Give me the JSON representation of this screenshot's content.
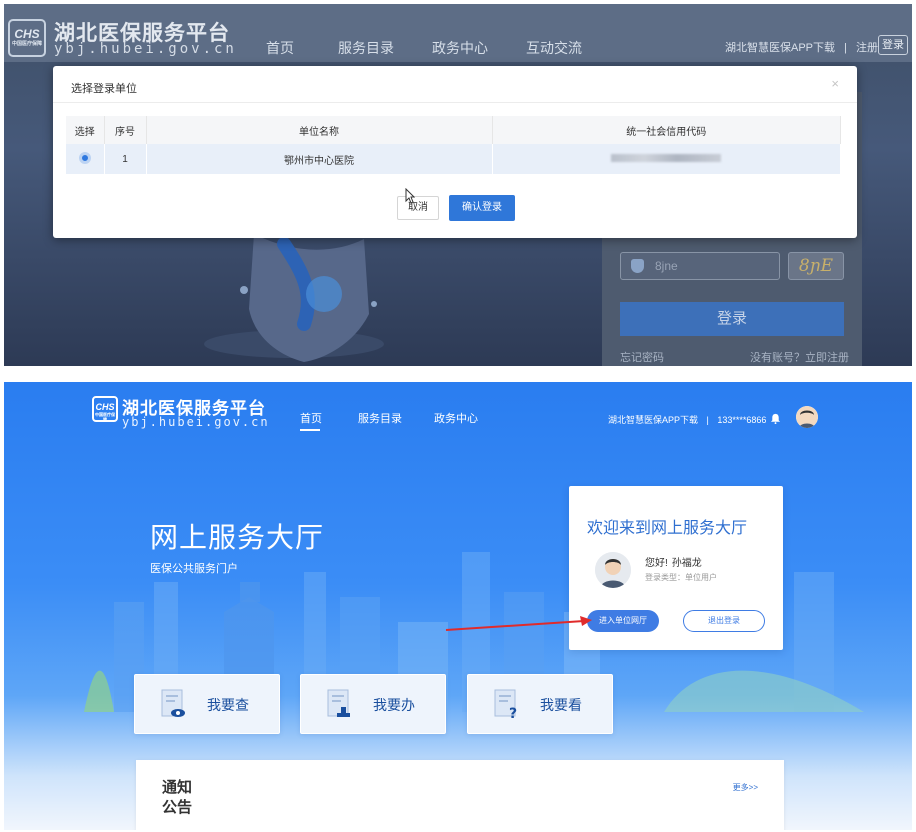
{
  "shot1": {
    "header": {
      "logo_text": "CHS",
      "logo_sub": "中国医疗保障",
      "site_name": "湖北医保服务平台",
      "site_url": "ybj.hubei.gov.cn",
      "nav": [
        "首页",
        "服务目录",
        "政务中心",
        "互动交流"
      ],
      "app_download": "湖北智慧医保APP下载",
      "separator": "|",
      "register": "注册",
      "login": "登录"
    },
    "modal": {
      "title": "选择登录单位",
      "close": "×",
      "columns": [
        "选择",
        "序号",
        "单位名称",
        "统一社会信用代码"
      ],
      "rows": [
        {
          "index": "1",
          "unit_name": "鄂州市中心医院",
          "credit_code_masked": true
        }
      ],
      "cancel": "取消",
      "confirm": "确认登录"
    },
    "login_form": {
      "captcha_placeholder": "8jne",
      "captcha_image_text": "8ɲE",
      "login_button": "登录",
      "forgot_password": "忘记密码",
      "register_prompt": "没有账号？立即注册"
    }
  },
  "shot2": {
    "header": {
      "logo_text": "CHS",
      "logo_sub": "中国医疗保障",
      "site_name": "湖北医保服务平台",
      "site_url": "ybj.hubei.gov.cn",
      "nav": [
        "首页",
        "服务目录",
        "政务中心"
      ],
      "app_download": "湖北智慧医保APP下载",
      "separator": "|",
      "phone": "133****6866"
    },
    "hero": {
      "title": "网上服务大厅",
      "subtitle": "医保公共服务门户"
    },
    "welcome": {
      "title": "欢迎来到网上服务大厅",
      "greeting": "您好!",
      "user_name": "孙福龙",
      "login_type": "登录类型：单位用户",
      "enter_button": "进入单位网厅",
      "logout_button": "退出登录"
    },
    "services": [
      "我要查",
      "我要办",
      "我要看"
    ],
    "notice": {
      "title": "通知公告",
      "more": "更多>>"
    }
  },
  "colors": {
    "primary_blue": "#2f77d9",
    "hero_blue": "#2a7df0",
    "arrow_red": "#e02b2b"
  }
}
